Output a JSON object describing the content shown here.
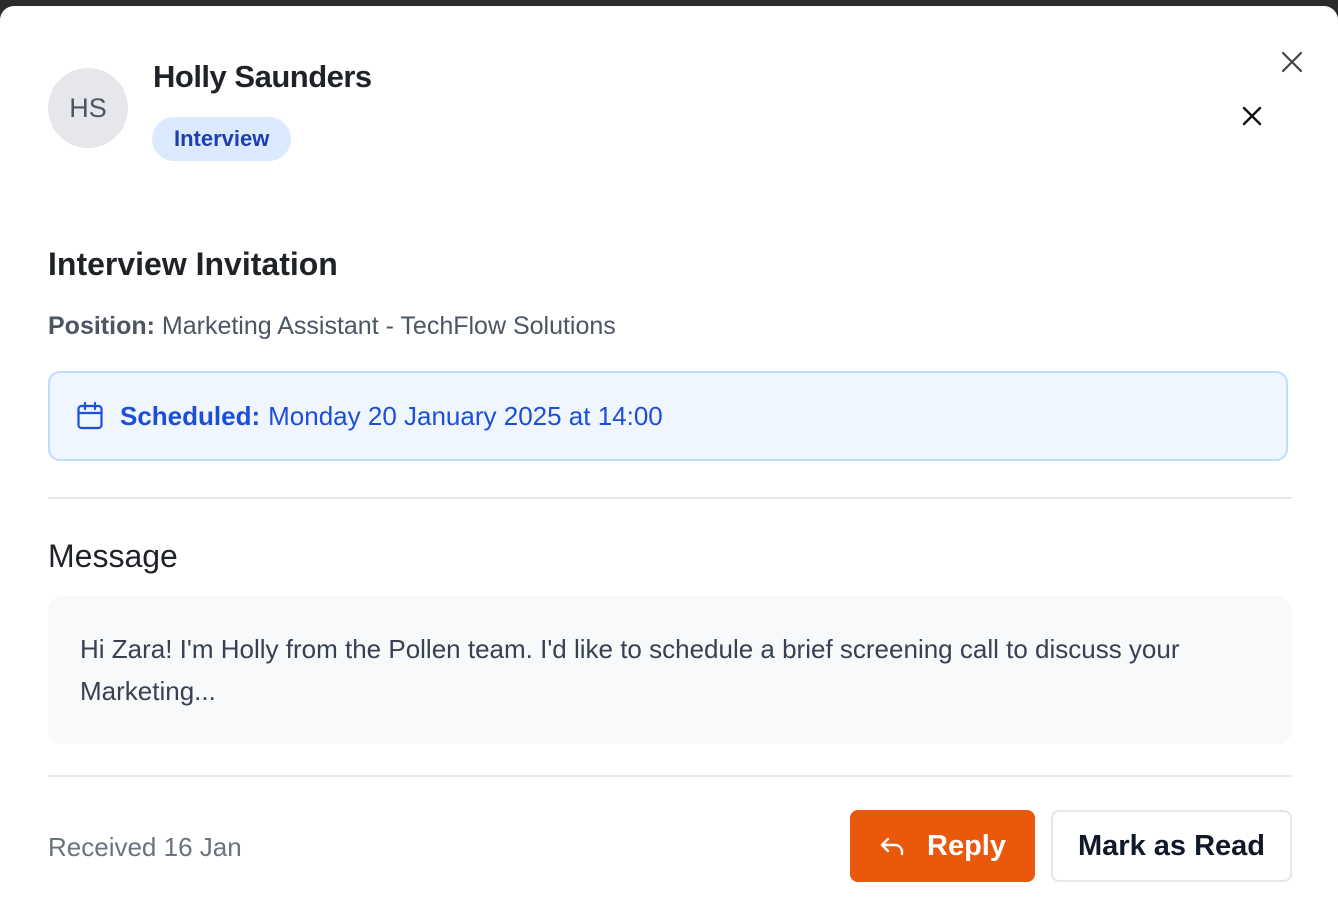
{
  "sender": {
    "initials": "HS",
    "name": "Holly Saunders",
    "tag": "Interview"
  },
  "icons": {
    "outer_close": "close-icon",
    "inner_close": "close-icon",
    "calendar": "calendar-icon",
    "reply": "reply-arrow-icon"
  },
  "title": "Interview Invitation",
  "position": {
    "label": "Position:",
    "value": "Marketing Assistant - TechFlow Solutions"
  },
  "schedule": {
    "label": "Scheduled:",
    "value": "Monday 20 January 2025 at 14:00"
  },
  "message": {
    "heading": "Message",
    "body": "Hi Zara! I'm Holly from the Pollen team. I'd like to schedule a brief screening call to discuss your Marketing..."
  },
  "footer": {
    "received": "Received 16 Jan",
    "reply_label": "Reply",
    "mark_read_label": "Mark as Read"
  },
  "colors": {
    "accent": "#ea580c",
    "tag_bg": "#dbeafe",
    "tag_text": "#1e40af",
    "schedule_bg": "#eff6ff",
    "schedule_text": "#1d4ed8"
  }
}
